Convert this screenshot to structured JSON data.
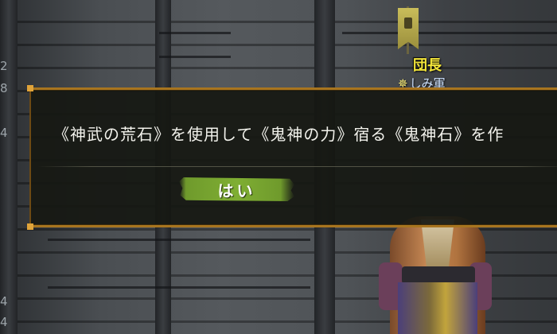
{
  "hud": {
    "left_numbers": [
      "2",
      "8",
      "4",
      "4",
      "4"
    ]
  },
  "npc": {
    "name": "団長",
    "guild": "しみ軍",
    "guild_icon": "sparkle-icon",
    "name_color": "#f4e63a"
  },
  "dialog": {
    "message": "《神武の荒石》を使用して《鬼神の力》宿る《鬼神石》を作",
    "yes_label": "はい",
    "border_color": "#a8751f",
    "button_color": "#7fae33"
  }
}
